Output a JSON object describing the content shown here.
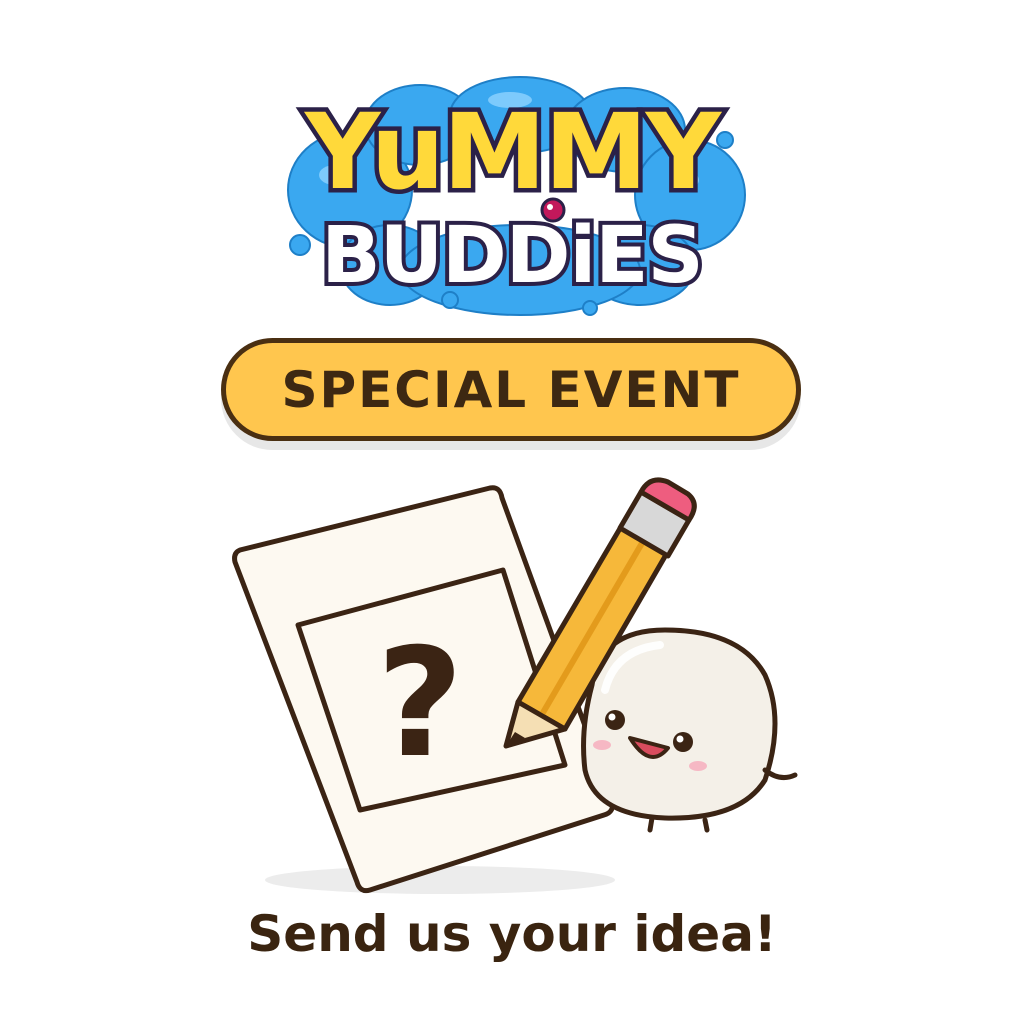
{
  "logo": {
    "line1": "YuMMY",
    "line2": "BUDDiES",
    "colors": {
      "yellow": "#ffd93a",
      "orange": "#f29a1b",
      "blue_splash": "#3aa8f0",
      "outline": "#2b2148",
      "white_text": "#ffffff"
    }
  },
  "banner": {
    "label": "SPECIAL EVENT",
    "fill": "#ffc64e",
    "border": "#4a2f12"
  },
  "illustration": {
    "paper_icon": "paper-icon",
    "question_icon": "question-mark-icon",
    "pencil_icon": "pencil-icon",
    "mascot": "rice-cake-mascot",
    "question_glyph": "?"
  },
  "cta": {
    "text": "Send us your idea!"
  }
}
